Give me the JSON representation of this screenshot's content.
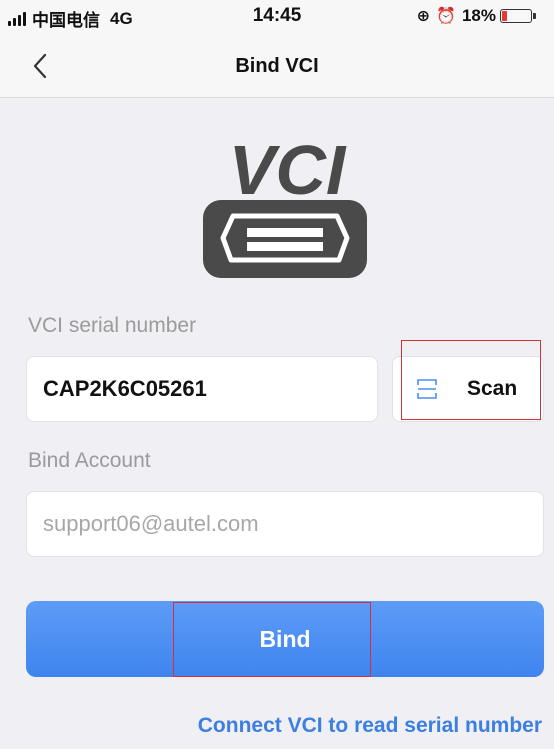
{
  "status_bar": {
    "carrier": "中国电信",
    "network": "4G",
    "time": "14:45",
    "battery_percent": "18%",
    "battery_level": 0.18,
    "battery_color": "#e53935"
  },
  "nav": {
    "title": "Bind VCI",
    "back_icon": "chevron-left-icon"
  },
  "logo": {
    "text": "VCI",
    "icon": "obd-connector-icon"
  },
  "form": {
    "serial_label": "VCI serial number",
    "serial_value": "CAP2K6C05261",
    "scan_label": "Scan",
    "scan_icon": "scan-frame-icon",
    "account_label": "Bind Account",
    "account_value": "support06@autel.com"
  },
  "bind_button": {
    "label": "Bind",
    "color": "#4a8ef2"
  },
  "connect_link": {
    "label": "Connect VCI to read serial number",
    "color": "#3c7fe0"
  },
  "highlight_color": "#d0343a"
}
